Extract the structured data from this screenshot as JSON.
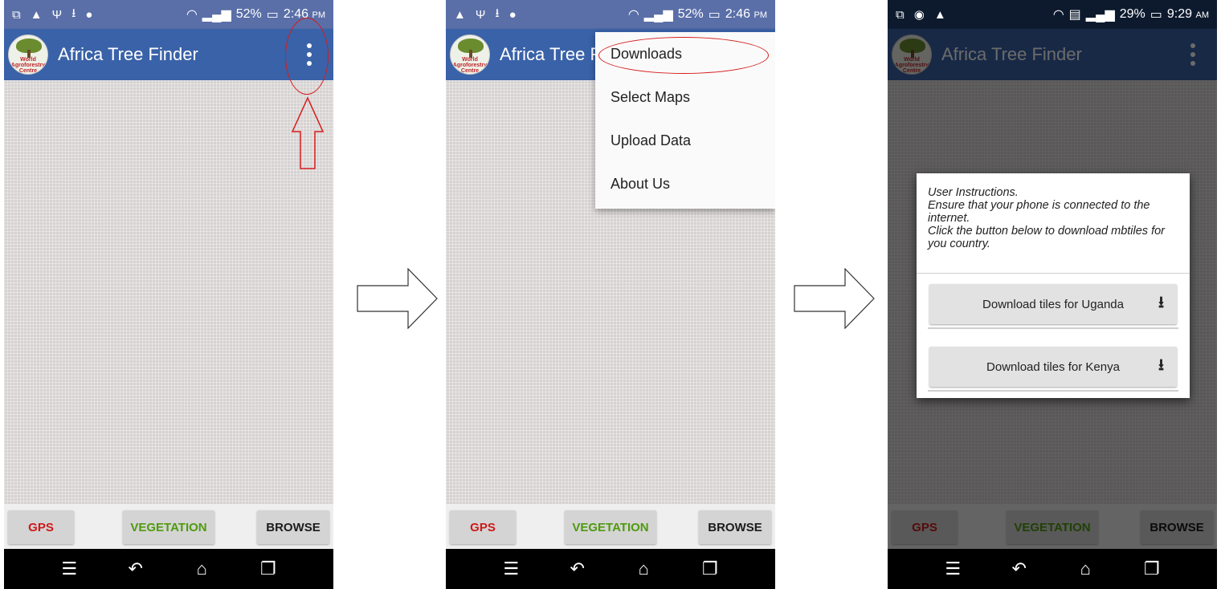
{
  "app_title": "Africa Tree Finder",
  "logo_text": "World Agroforestry Centre",
  "status": {
    "p1": {
      "battery": "52%",
      "time": "2:46",
      "ampm": "PM"
    },
    "p2": {
      "battery": "52%",
      "time": "2:46",
      "ampm": "PM"
    },
    "p3": {
      "battery": "29%",
      "time": "9:29",
      "ampm": "AM"
    }
  },
  "toolbar": {
    "gps": "GPS",
    "vegetation": "VEGETATION",
    "browse": "BROWSE"
  },
  "menu": [
    "Downloads",
    "Select Maps",
    "Upload Data",
    "About Us"
  ],
  "dialog": {
    "line1": "User Instructions.",
    "line2": "Ensure that your phone is connected to the internet.",
    "line3": "Click the button below to download mbtiles for you country.",
    "buttons": [
      "Download tiles for Uganda",
      "Download tiles for Kenya"
    ]
  },
  "colors": {
    "appbar": "#3a62a8",
    "gps": "#d01818",
    "vegetation": "#4f9a0e",
    "annotation": "#d61c1c"
  }
}
